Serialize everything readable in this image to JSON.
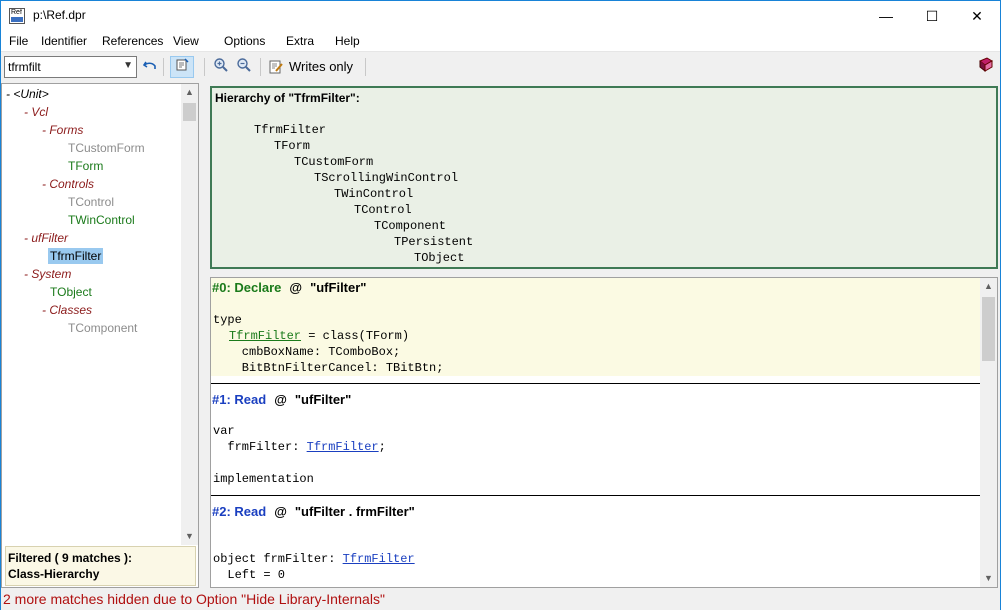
{
  "window": {
    "title": "p:\\Ref.dpr",
    "icon_text": "Ref",
    "controls": {
      "minimize": "—",
      "maximize": "☐",
      "close": "✕"
    }
  },
  "menu": [
    "File",
    "Identifier",
    "References",
    "View",
    "Options",
    "Extra",
    "Help"
  ],
  "toolbar": {
    "search_value": "tfrmfilt",
    "writes_only_label": "Writes only"
  },
  "tree": {
    "nodes": [
      {
        "prefix": "- ",
        "label": "<Unit>"
      },
      {
        "prefix": "- ",
        "label": "Vcl"
      },
      {
        "prefix": "- ",
        "label": "Forms"
      },
      {
        "prefix": "",
        "label": "TCustomForm"
      },
      {
        "prefix": "",
        "label": "TForm"
      },
      {
        "prefix": "- ",
        "label": "Controls"
      },
      {
        "prefix": "",
        "label": "TControl"
      },
      {
        "prefix": "",
        "label": "TWinControl"
      },
      {
        "prefix": "- ",
        "label": "ufFilter"
      },
      {
        "prefix": "",
        "label": "TfrmFilter"
      },
      {
        "prefix": "- ",
        "label": "System"
      },
      {
        "prefix": "",
        "label": "TObject"
      },
      {
        "prefix": "- ",
        "label": "Classes"
      },
      {
        "prefix": "",
        "label": "TComponent"
      }
    ],
    "footer_line1": "Filtered  ( 9 matches ):",
    "footer_line2": "Class-Hierarchy"
  },
  "hierarchy": {
    "title": "Hierarchy of \"TfrmFilter\":",
    "items": [
      "TfrmFilter",
      "TForm",
      "TCustomForm",
      "TScrollingWinControl",
      "TWinControl",
      "TControl",
      "TComponent",
      "TPersistent",
      "TObject"
    ]
  },
  "results": [
    {
      "kind": "#0: Declare",
      "at": "@",
      "unit": "\"ufFilter\"",
      "lines": {
        "l1": "type",
        "l2_ref": "TfrmFilter",
        "l2_rest": " = class(TForm)",
        "l3": "    cmbBoxName: TComboBox;",
        "l4": "    BitBtnFilterCancel: TBitBtn;"
      }
    },
    {
      "kind": "#1: Read",
      "at": "@",
      "unit": "\"ufFilter\"",
      "lines": {
        "l1": "var",
        "l2_pre": "  frmFilter: ",
        "l2_ref": "TfrmFilter",
        "l2_post": ";",
        "l3": "implementation"
      }
    },
    {
      "kind": "#2: Read",
      "at": "@",
      "unit": "\"ufFilter . frmFilter\"",
      "lines": {
        "l1_pre": "object frmFilter: ",
        "l1_ref": "TfrmFilter",
        "l2": "  Left = 0"
      }
    }
  ],
  "status": "2 more matches hidden due to Option \"Hide Library-Internals\"",
  "colors": {
    "accent_border": "#1883d7",
    "tree_group": "#8b1a1a",
    "tree_used": "#1a7a1a",
    "tree_unused": "#8c8c8c",
    "declare_head": "#1a7a1a",
    "read_head": "#1a3fc0",
    "status_text": "#b01010"
  }
}
